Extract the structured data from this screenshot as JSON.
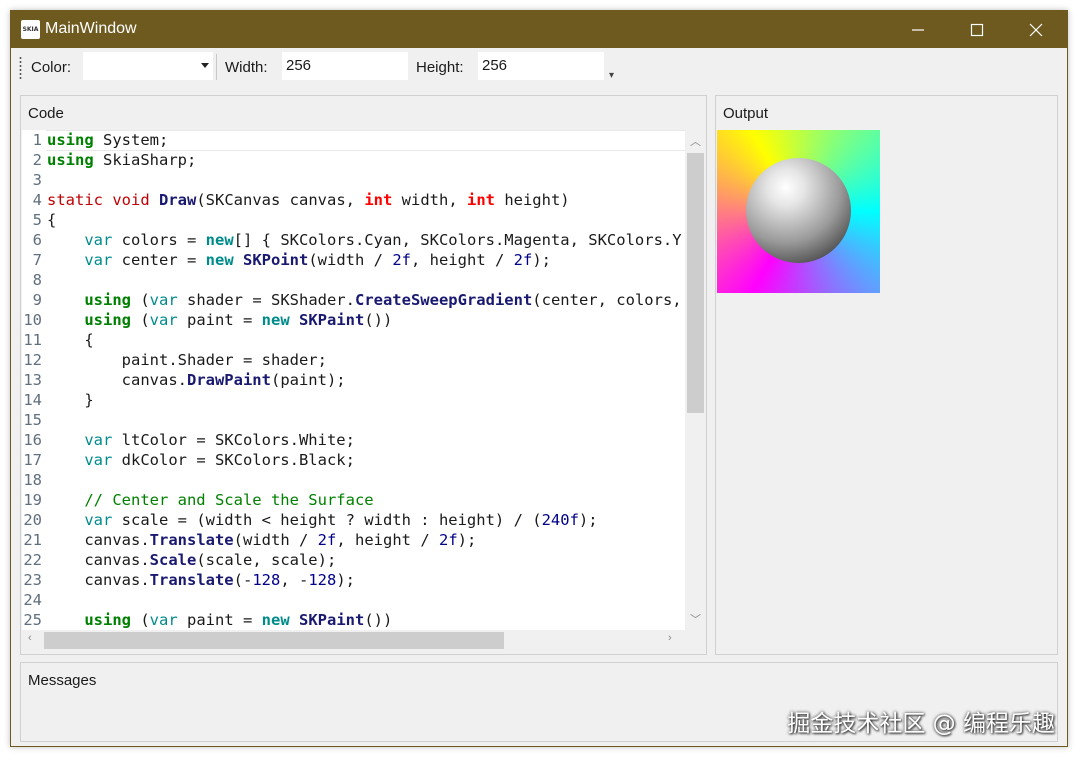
{
  "window": {
    "title": "MainWindow",
    "icon_text": "SKIA"
  },
  "toolbar": {
    "color_label": "Color:",
    "color_value": "",
    "width_label": "Width:",
    "width_value": "256",
    "height_label": "Height:",
    "height_value": "256"
  },
  "code_panel": {
    "title": "Code",
    "lines": [
      {
        "n": "1",
        "t": "using System;"
      },
      {
        "n": "2",
        "t": "using SkiaSharp;"
      },
      {
        "n": "3",
        "t": ""
      },
      {
        "n": "4",
        "t": "static void Draw(SKCanvas canvas, int width, int height)"
      },
      {
        "n": "5",
        "t": "{"
      },
      {
        "n": "6",
        "t": "    var colors = new[] { SKColors.Cyan, SKColors.Magenta, SKColors.Y"
      },
      {
        "n": "7",
        "t": "    var center = new SKPoint(width / 2f, height / 2f);"
      },
      {
        "n": "8",
        "t": ""
      },
      {
        "n": "9",
        "t": "    using (var shader = SKShader.CreateSweepGradient(center, colors,"
      },
      {
        "n": "10",
        "t": "    using (var paint = new SKPaint())"
      },
      {
        "n": "11",
        "t": "    {"
      },
      {
        "n": "12",
        "t": "        paint.Shader = shader;"
      },
      {
        "n": "13",
        "t": "        canvas.DrawPaint(paint);"
      },
      {
        "n": "14",
        "t": "    }"
      },
      {
        "n": "15",
        "t": ""
      },
      {
        "n": "16",
        "t": "    var ltColor = SKColors.White;"
      },
      {
        "n": "17",
        "t": "    var dkColor = SKColors.Black;"
      },
      {
        "n": "18",
        "t": ""
      },
      {
        "n": "19",
        "t": "    // Center and Scale the Surface"
      },
      {
        "n": "20",
        "t": "    var scale = (width < height ? width : height) / (240f);"
      },
      {
        "n": "21",
        "t": "    canvas.Translate(width / 2f, height / 2f);"
      },
      {
        "n": "22",
        "t": "    canvas.Scale(scale, scale);"
      },
      {
        "n": "23",
        "t": "    canvas.Translate(-128, -128);"
      },
      {
        "n": "24",
        "t": ""
      },
      {
        "n": "25",
        "t": "    using (var paint = new SKPaint())"
      }
    ]
  },
  "output_panel": {
    "title": "Output"
  },
  "messages_panel": {
    "title": "Messages"
  },
  "watermark": "掘金技术社区 @ 编程乐趣",
  "colors": {
    "titlebar": "#6e5a1f",
    "keyword": "#008000",
    "type_keyword": "#ff0000",
    "method": "#191970"
  }
}
